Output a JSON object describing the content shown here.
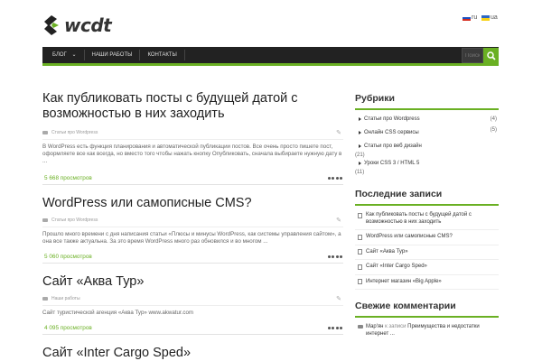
{
  "brand": {
    "logo_text": "wcdt",
    "accent_color": "#6ab023",
    "dark_color": "#222222"
  },
  "languages": [
    {
      "code": "ru",
      "label": "ru"
    },
    {
      "code": "ua",
      "label": "ua"
    }
  ],
  "nav": {
    "items": [
      "Блог",
      "Наши работы",
      "Контакты"
    ],
    "search_placeholder": "Поиск"
  },
  "posts": [
    {
      "title": "Как публиковать посты с будущей датой с возможностью в них заходить",
      "category": "Статьи про Wordpress",
      "excerpt": "В WordPress есть функция планирования и автоматической публикации постов. Все очень просто пишете пост, оформляете все как всегда, но вместо того чтобы нажать кнопку Опубликовать, сначала выбираете нужную дату в ...",
      "views": "5 668 просмотров"
    },
    {
      "title": "WordPress или самописные CMS?",
      "category": "Статьи про Wordpress",
      "excerpt": "Прошло много времени с дня написания статьи «Плюсы и минусы WordPress, как системы управления сайтом», а она все также актуальна. За это время WordPress много раз обновился и во многом ...",
      "views": "5 060 просмотров"
    },
    {
      "title": "Сайт «Аква Тур»",
      "category": "Наши работы",
      "excerpt": "Сайт туристической агенция «Аква Тур» www.akwatur.com",
      "views": "4 095 просмотров"
    },
    {
      "title": "Сайт «Inter Cargo Sped»"
    }
  ],
  "sidebar": {
    "rubrics": {
      "title": "Рубрики",
      "items": [
        {
          "label": "Статьи про Wordpress",
          "count": "(4)"
        },
        {
          "label": "Онлайн CSS сервисы",
          "count": "(5)"
        },
        {
          "label": "Статьи про веб дизайн",
          "count": "(21)"
        },
        {
          "label": "Уроки CSS 3 / HTML 5",
          "count": "(11)"
        }
      ]
    },
    "recent": {
      "title": "Последние записи",
      "items": [
        "Как публиковать посты с будущей датой с возможностью в них заходить",
        "WordPress или самописные CMS?",
        "Сайт «Аква Тур»",
        "Сайт «Inter Cargo Sped»",
        "Интернет магазин «Big Apple»"
      ]
    },
    "comments": {
      "title": "Свежие комментарии",
      "items": [
        {
          "author": "Мар'ян",
          "on": "к записи",
          "post": "Преимущества и недостатки интернет ..."
        }
      ]
    }
  }
}
